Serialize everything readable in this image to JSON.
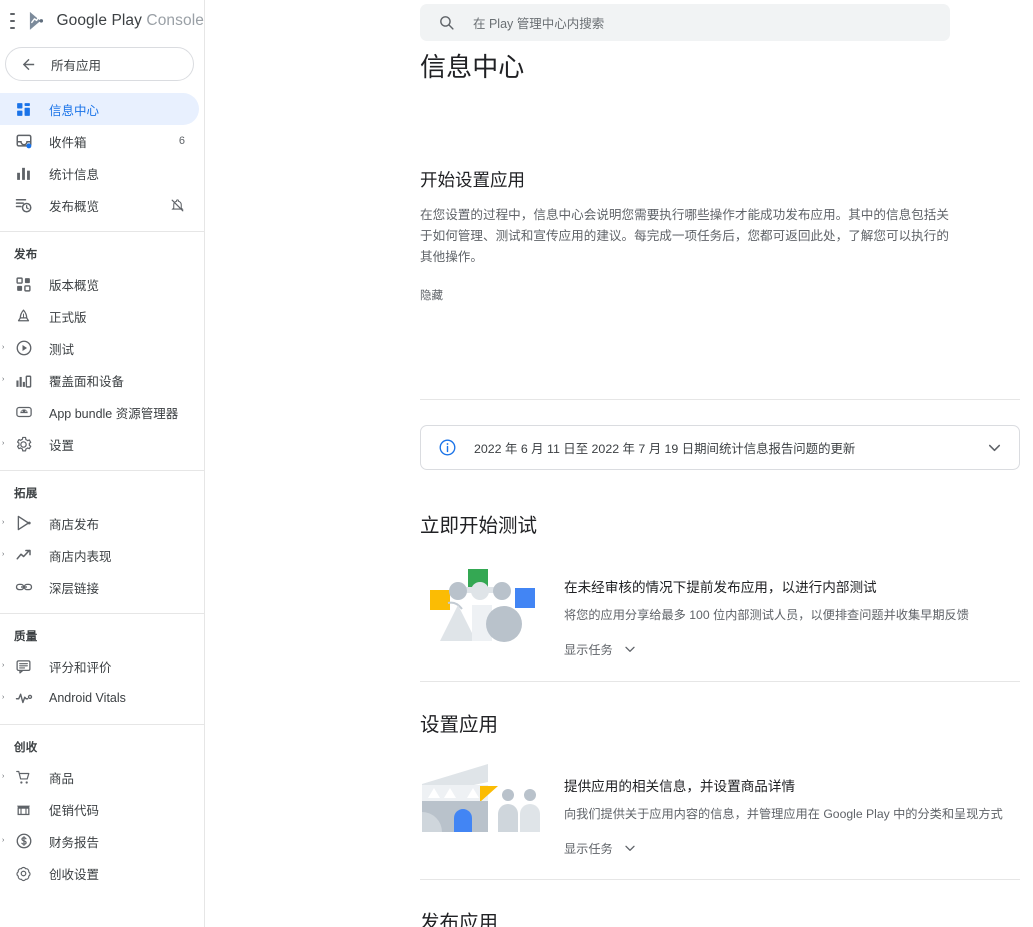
{
  "brand": {
    "logo_icon": "google-play-logo-icon",
    "menu_icon": "hamburger-menu-icon",
    "name_primary": "Google Play",
    "name_secondary": "Console"
  },
  "sidebar": {
    "all_apps": {
      "label": "所有应用",
      "icon": "arrow-back-icon"
    },
    "primary_items": [
      {
        "label": "信息中心",
        "icon": "dashboard-icon",
        "active": true,
        "badge": "",
        "trailing_icon": "",
        "expandable": false
      },
      {
        "label": "收件箱",
        "icon": "inbox-icon",
        "active": false,
        "badge": "6",
        "trailing_icon": "",
        "expandable": false
      },
      {
        "label": "统计信息",
        "icon": "bar-chart-icon",
        "active": false,
        "badge": "",
        "trailing_icon": "",
        "expandable": false
      },
      {
        "label": "发布概览",
        "icon": "publishing-overview-icon",
        "active": false,
        "badge": "",
        "trailing_icon": "notifications-off-icon",
        "expandable": false
      }
    ],
    "sections": [
      {
        "title": "发布",
        "items": [
          {
            "label": "版本概览",
            "icon": "releases-overview-icon",
            "expandable": false
          },
          {
            "label": "正式版",
            "icon": "production-rocket-icon",
            "expandable": false
          },
          {
            "label": "测试",
            "icon": "testing-play-circle-icon",
            "expandable": true
          },
          {
            "label": "覆盖面和设备",
            "icon": "reach-devices-icon",
            "expandable": true
          },
          {
            "label": "App bundle 资源管理器",
            "icon": "app-bundle-explorer-icon",
            "expandable": false
          },
          {
            "label": "设置",
            "icon": "gear-icon",
            "expandable": true
          }
        ]
      },
      {
        "title": "拓展",
        "items": [
          {
            "label": "商店发布",
            "icon": "store-presence-icon",
            "expandable": true
          },
          {
            "label": "商店内表现",
            "icon": "store-performance-trending-icon",
            "expandable": true
          },
          {
            "label": "深层链接",
            "icon": "deep-links-icon",
            "expandable": false
          }
        ]
      },
      {
        "title": "质量",
        "items": [
          {
            "label": "评分和评价",
            "icon": "ratings-reviews-icon",
            "expandable": true
          },
          {
            "label": "Android Vitals",
            "icon": "android-vitals-pulse-icon",
            "expandable": true
          }
        ]
      },
      {
        "title": "创收",
        "items": [
          {
            "label": "商品",
            "icon": "shopping-cart-icon",
            "expandable": true
          },
          {
            "label": "促销代码",
            "icon": "promo-codes-store-icon",
            "expandable": false
          },
          {
            "label": "财务报告",
            "icon": "financial-reports-dollar-icon",
            "expandable": true
          },
          {
            "label": "创收设置",
            "icon": "monetization-setup-icon",
            "expandable": false
          }
        ]
      }
    ]
  },
  "search": {
    "icon": "search-icon",
    "placeholder": "在 Play 管理中心内搜索"
  },
  "page": {
    "title": "信息中心"
  },
  "setup_intro": {
    "heading": "开始设置应用",
    "body": "在您设置的过程中，信息中心会说明您需要执行哪些操作才能成功发布应用。其中的信息包括关于如何管理、测试和宣传应用的建议。每完成一项任务后，您都可返回此处，了解您可以执行的其他操作。",
    "hide_label": "隐藏"
  },
  "notice": {
    "icon": "info-circle-icon",
    "text": "2022 年 6 月 11 日至 2022 年 7 月 19 日期间统计信息报告问题的更新",
    "expand_icon": "chevron-down-icon"
  },
  "sections": [
    {
      "heading": "立即开始测试",
      "illustration": "internal-testing-people-illustration",
      "task_title": "在未经审核的情况下提前发布应用，以进行内部测试",
      "task_desc": "将您的应用分享给最多 100 位内部测试人员，以便排查问题并收集早期反馈",
      "toggle_label": "显示任务",
      "toggle_icon": "chevron-down-icon"
    },
    {
      "heading": "设置应用",
      "illustration": "store-listing-storefront-illustration",
      "task_title": "提供应用的相关信息，并设置商品详情",
      "task_desc": "向我们提供关于应用内容的信息，并管理应用在 Google Play 中的分类和呈现方式",
      "toggle_label": "显示任务",
      "toggle_icon": "chevron-down-icon"
    }
  ],
  "bottom_section": {
    "heading": "发布应用"
  },
  "colors": {
    "accent_blue": "#1a73e8",
    "active_pill": "#e8f0fe",
    "text_primary": "#202124",
    "text_secondary": "#5f6368",
    "search_bg": "#f1f3f4",
    "border": "#dadce0",
    "illu_green": "#34a853",
    "illu_yellow": "#fbbc04",
    "illu_blue": "#4285f4",
    "illu_gray": "#c3cbd3"
  }
}
